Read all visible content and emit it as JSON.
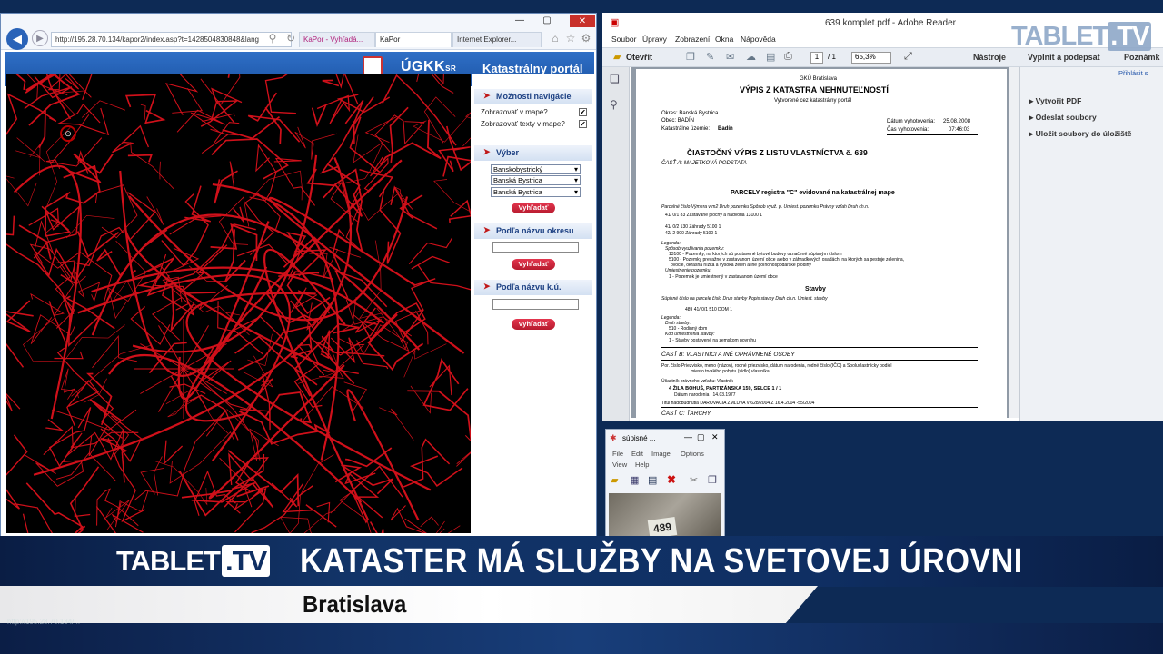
{
  "ie": {
    "address": "http://195.28.70.134/kapor2/index.asp?t=1428504830848&lang",
    "tabs": [
      "KaPor - Vyhľadá...",
      "KaPor",
      "Internet Explorer..."
    ],
    "status_url": "http://195.28.70.134/..."
  },
  "portal": {
    "ugkk": "ÚGKK",
    "ugkk_sr": "SR",
    "title": "Katastrálny portál",
    "nav_header": "Možnosti navigácie",
    "show_in_map": "Zobrazovať v mape?",
    "show_texts": "Zobrazovať texty v mape?",
    "vyber_header": "Výber",
    "selects": [
      "Banskobystrický",
      "Banská Bystrica",
      "Banská Bystrica"
    ],
    "search_label": "Vyhľadať",
    "okres_header": "Podľa názvu okresu",
    "ku_header": "Podľa názvu k.ú."
  },
  "reader": {
    "window_title": "639 komplet.pdf - Adobe Reader",
    "menu": [
      "Soubor",
      "Úpravy",
      "Zobrazení",
      "Okna",
      "Nápověda"
    ],
    "open": "Otevřít",
    "page": "1",
    "page_total": "/ 1",
    "zoom": "65,3%",
    "tools": "Nástroje",
    "fill_sign": "Vyplnit a podepsat",
    "notes": "Poznámk",
    "login": "Přihlásit s",
    "right_panel": [
      "Vytvořit PDF",
      "Odeslat soubory",
      "Uložit soubory do úložiště"
    ]
  },
  "pdf": {
    "office": "GKÚ Bratislava",
    "title": "VÝPIS Z KATASTRA NEHNUTEĽNOSTÍ",
    "subtitle": "Vytvorené cez katastrálny portál",
    "okres": "Okres: Banská Bystrica",
    "obec": "Obec: BADÍN",
    "ku_label": "Katastrálne územie:",
    "ku_value": "Badín",
    "date_label": "Dátum vyhotovenia:",
    "date_value": "25.08.2008",
    "time_label": "Čas vyhotovenia:",
    "time_value": "07:46:03",
    "lv_title": "ČIASTOČNÝ  VÝPIS Z LISTU VLASTNÍCTVA  č.   639",
    "part_a": "ČASŤ A: MAJETKOVÁ PODSTATA",
    "parcels_title": "PARCELY registra \"C\" evidované na katastrálnej mape",
    "parcel_headers": "Parcelné číslo      Výmera v m2  Druh pozemku                   Spôsob využ. p.  Umiest. pozemku  Právny vzťah  Druh ch.n.",
    "parcel_rows": [
      "41/ 0/1                        83   Zastavané plochy a nádvoria          13100              1",
      "41/ 0/2                      130   Záhrady                                  5100              1",
      "42/ 2                         900   Záhrady                                  5100              1"
    ],
    "legend_lines": [
      "Legenda:",
      "Spôsob využívania pozemku:",
      "13100 - Pozemky, na ktorých sú postavené bytové budovy označené súpisným číslom",
      "5100 - Pozemky prevažne v zastavanom území obce alebo v záhradkových osadách, na ktorých sa pestuje zelenina,",
      "ovocie, okrasná nízka a vysoká zeleň a iné poľnohospodárske plodiny",
      "Umiestnenie pozemku:",
      "1 - Pozemok je umiestnený v zastavanom území obce"
    ],
    "stavby": "Stavby",
    "stavby_headers": "Súpisné číslo   na parcele číslo   Druh stavby   Popis stavby                                    Druh ch.n.   Umiest. stavby",
    "stavby_row": "489     41/ 0/1              510  DOM                                                                                        1",
    "stavby_legend": [
      "Legenda:",
      "Druh stavby:",
      "510 - Rodinný dom",
      "Kód umiestnenia stavby:",
      "1 - Stavby postavené na zemskom povrchu"
    ],
    "part_b": "ČASŤ B: VLASTNÍCI A INÉ OPRÁVNENÉ OSOBY",
    "owner_headers": "Por. číslo   Priezvisko, meno (názov), rodné priezvisko, dátum narodenia, rodné číslo (IČO) a   Spoluvlastnícky podiel",
    "owner_headers2": "miesto trvalého pobytu (sídlo) vlastníka",
    "owner_type": "Účastník právneho vzťahu:                Vlastník",
    "owner_name": "4  ŽILA BOHUŠ, PARTIZÁNSKA 159, SELCE                                                1 / 1",
    "owner_dob": "Dátum narodenia :          14.03.1977",
    "title_acq": "Titul nadobudnutia         DAROVACIA ZMLUVA V 628/2004 Z 16.4.2004 -55/2004",
    "part_c": "ČASŤ C: ŤARCHY"
  },
  "paint": {
    "title": "súpisné ...",
    "menu": [
      "File",
      "Edit",
      "Image",
      "Options",
      "View",
      "Help"
    ],
    "image_text": "489"
  },
  "overlay": {
    "logo": "TABLET",
    "logo_tv": ".TV",
    "headline": "KATASTER MÁ SLUŽBY NA SVETOVEJ ÚROVNI",
    "location": "Bratislava"
  },
  "colors": {
    "map_lines": "#d0101a",
    "portal_blue": "#1d56a8",
    "button_red": "#c8203a",
    "lower_third_blue": "#123468"
  }
}
